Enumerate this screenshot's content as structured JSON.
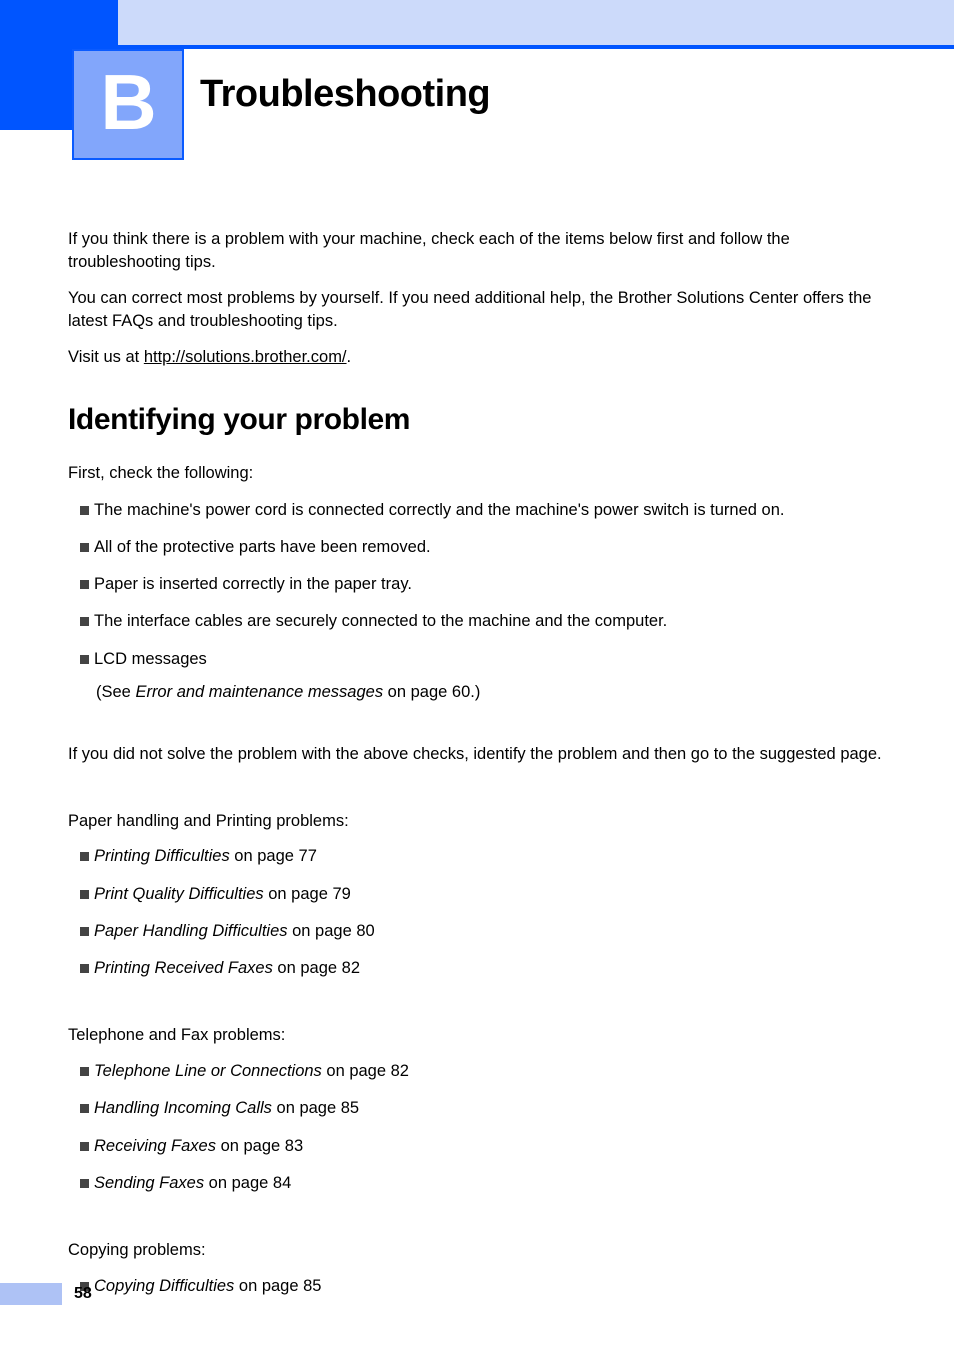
{
  "header": {
    "chapter_letter": "B",
    "chapter_title": "Troubleshooting",
    "colors": {
      "dark_blue": "#0055ff",
      "pale_blue": "#ccdafa",
      "chapter_box_blue": "#82a6fb",
      "footer_bar_blue": "#aec2f5"
    }
  },
  "intro": {
    "paragraph_1": "If you think there is a problem with your machine, check each of the items below first and follow the troubleshooting tips.",
    "paragraph_2": "You can correct most problems by yourself. If you need additional help, the Brother Solutions Center offers the latest FAQs and troubleshooting tips.",
    "visit_prefix": "Visit us at ",
    "visit_url": "http://solutions.brother.com/",
    "visit_suffix": "."
  },
  "section": {
    "heading": "Identifying your problem",
    "lead": "First, check the following:",
    "checks": [
      "The machine's power cord is connected correctly and the machine's power switch is turned on.",
      "All of the protective parts have been removed.",
      "Paper is inserted correctly in the paper tray.",
      "The interface cables are securely connected to the machine and the computer.",
      "LCD messages"
    ],
    "lcd_note": {
      "prefix": "(See ",
      "ref": "Error and maintenance messages",
      "suffix": " on page 60.)"
    },
    "after_checks": "If you did not solve the problem with the above checks, identify the problem and then go to the suggested page."
  },
  "groups": [
    {
      "label": "Paper handling and Printing problems:",
      "items": [
        {
          "ref": "Printing Difficulties",
          "tail": " on page 77"
        },
        {
          "ref": "Print Quality Difficulties",
          "tail": " on page 79"
        },
        {
          "ref": "Paper Handling Difficulties",
          "tail": " on page 80"
        },
        {
          "ref": "Printing Received Faxes",
          "tail": " on page 82"
        }
      ]
    },
    {
      "label": "Telephone and Fax problems:",
      "items": [
        {
          "ref": "Telephone Line or Connections",
          "tail": " on page 82"
        },
        {
          "ref": "Handling Incoming Calls",
          "tail": " on page 85"
        },
        {
          "ref": "Receiving Faxes",
          "tail": " on page 83"
        },
        {
          "ref": "Sending Faxes",
          "tail": " on page 84"
        }
      ]
    },
    {
      "label": "Copying problems:",
      "items": [
        {
          "ref": "Copying Difficulties",
          "tail": " on page 85"
        }
      ]
    }
  ],
  "footer": {
    "page_number": "58"
  }
}
